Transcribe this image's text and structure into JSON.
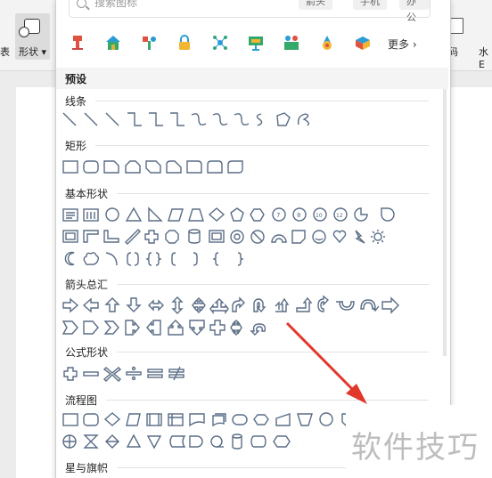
{
  "ribbon": {
    "shape_button_label": "形状",
    "left_cut_label": "表",
    "right_cut_label_1": "码",
    "right_cut_label_2": "水E"
  },
  "panel": {
    "search_placeholder": "搜索图标",
    "search_tags": [
      "箭头",
      "手机",
      "办公"
    ],
    "more_label": "更多",
    "preset_header": "预设",
    "sections": [
      "线条",
      "矩形",
      "基本形状",
      "箭头总汇",
      "公式形状",
      "流程图",
      "星与旗帜"
    ],
    "icon_row": [
      "podium-icon",
      "house-icon",
      "tools-icon",
      "lock-icon",
      "network-icon",
      "presentation-icon",
      "team-icon",
      "medal-icon",
      "box-icon"
    ]
  },
  "watermark": {
    "text": "软件技巧"
  },
  "colors": {
    "shape_stroke": "#5a6d85",
    "arrow": "#e2382b",
    "panel_bg": "#ffffff"
  }
}
